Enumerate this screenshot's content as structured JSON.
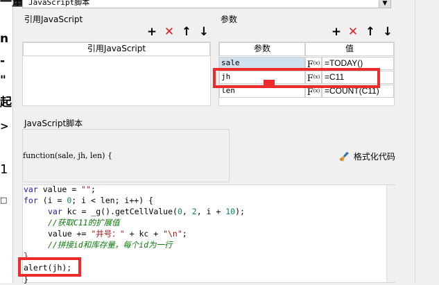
{
  "left_strip": {
    "texts": [
      "一量",
      "n",
      "-",
      "\"",
      "起",
      ">",
      "1",
      "□"
    ]
  },
  "top_combo": {
    "value": "JavaScript脚本"
  },
  "referenced_js": {
    "group_label": "引用JavaScript",
    "column_header": "引用JavaScript"
  },
  "params": {
    "group_label": "参数",
    "header_name": "参数",
    "header_value": "值",
    "rows": [
      {
        "name": "sale",
        "fx": "F",
        "fx_sub": "(x)",
        "value": "=TODAY()"
      },
      {
        "name": "jh",
        "fx": "F",
        "fx_sub": "(x)",
        "value": "=C11"
      },
      {
        "name": "len",
        "fx": "F",
        "fx_sub": "(x)",
        "value": "=COUNT(C11)"
      }
    ]
  },
  "script": {
    "group_label": "JavaScript脚本",
    "signature": "function(sale, jh, len) {",
    "format_button": "格式化代码",
    "code": {
      "l1": [
        "var",
        " value = ",
        "\"\"",
        ";"
      ],
      "l2": [
        "for",
        " (i = ",
        "0",
        "; i < len; i++) {"
      ],
      "l3": [
        "var",
        " kc = _g().getCellValue(",
        "0",
        ", ",
        "2",
        ", i + ",
        "10",
        ");"
      ],
      "l4": "//获取C11的扩展值",
      "l5": [
        "value += ",
        "\"井号：\"",
        " + kc + ",
        "\"\\n\"",
        ";"
      ],
      "l6": "//拼接id和库存量，每个id为一行",
      "l7": "}",
      "l8": "alert(jh);",
      "l9": "}"
    }
  }
}
